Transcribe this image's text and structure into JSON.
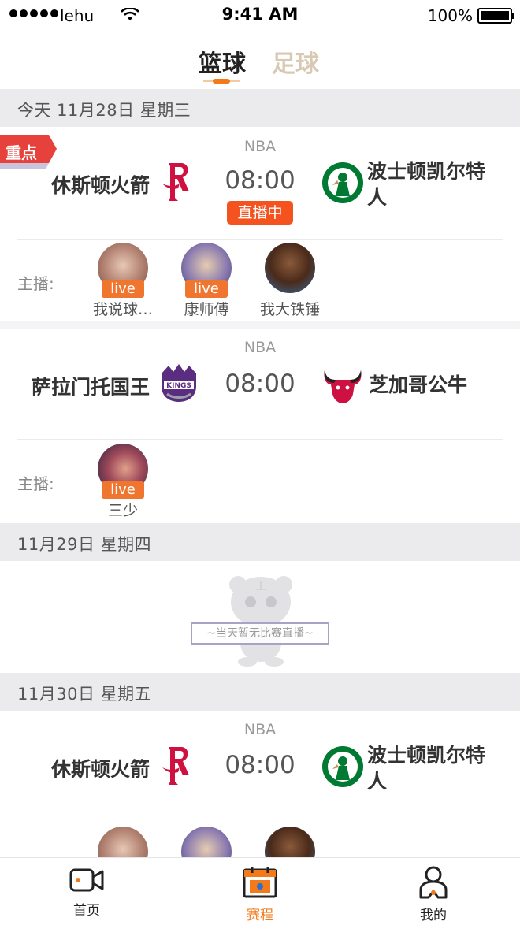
{
  "status_bar": {
    "carrier": "lehu",
    "time": "9:41 AM",
    "battery": "100%"
  },
  "top_tabs": [
    {
      "label": "篮球",
      "active": true
    },
    {
      "label": "足球",
      "active": false
    }
  ],
  "featured_badge": "重点",
  "anchors_label": "主播:",
  "live_tag": "live",
  "days": [
    {
      "date": "今天 11月28日 星期三"
    },
    {
      "date": "11月29日 星期四",
      "empty_text": "~当天暂无比赛直播~"
    },
    {
      "date": "11月30日 星期五"
    }
  ],
  "games": [
    {
      "league": "NBA",
      "home": "休斯顿火箭",
      "away": "波士顿凯尔特人",
      "time": "08:00",
      "status": "直播中",
      "anchors": [
        {
          "name": "我说球…",
          "live": true
        },
        {
          "name": "康师傅",
          "live": true
        },
        {
          "name": "我大铁锤",
          "live": false
        }
      ]
    },
    {
      "league": "NBA",
      "home": "萨拉门托国王",
      "away": "芝加哥公牛",
      "time": "08:00",
      "anchors": [
        {
          "name": "三少",
          "live": true
        }
      ]
    },
    {
      "league": "NBA",
      "home": "休斯顿火箭",
      "away": "波士顿凯尔特人",
      "time": "08:00",
      "anchors": [
        {
          "name": "",
          "live": false
        },
        {
          "name": "",
          "live": false
        },
        {
          "name": "",
          "live": false
        }
      ]
    }
  ],
  "tabbar": [
    {
      "label": "首页",
      "icon": "video-camera-icon",
      "active": false
    },
    {
      "label": "赛程",
      "icon": "calendar-icon",
      "active": true
    },
    {
      "label": "我的",
      "icon": "person-icon",
      "active": false
    }
  ],
  "colors": {
    "accent": "#f27a1a",
    "live_red": "#f4521e",
    "tab_inactive": "#d8c9b2",
    "header_bg": "#ebebed",
    "rockets_red": "#ce1141",
    "kings_purple": "#5a2d81",
    "celtics_green": "#007a33",
    "bulls_red": "#ce1141"
  }
}
